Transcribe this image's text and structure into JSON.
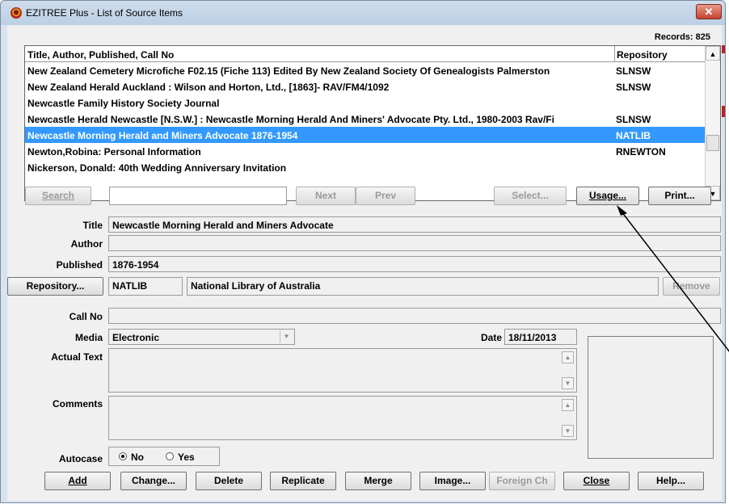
{
  "window": {
    "title": "EZITREE Plus - List of Source Items",
    "close_glyph": "✕"
  },
  "records_label": "Records: 825",
  "list": {
    "columns": [
      "Title, Author, Published, Call No",
      "Repository"
    ],
    "rows": [
      {
        "title": "New Zealand Cemetery Microfiche F02.15 (Fiche 113) Edited By New Zealand Society Of Genealogists Palmerston",
        "repo": "SLNSW"
      },
      {
        "title": "New Zealand Herald  Auckland : Wilson and Horton, Ltd., [1863]- RAV/FM4/1092",
        "repo": "SLNSW"
      },
      {
        "title": "Newcastle Family History Society Journal",
        "repo": ""
      },
      {
        "title": "Newcastle Herald  Newcastle [N.S.W.] : Newcastle Morning Herald And Miners' Advocate Pty. Ltd., 1980-2003 Rav/Fi",
        "repo": "SLNSW"
      },
      {
        "title": "Newcastle Morning Herald and Miners Advocate  1876-1954",
        "repo": "NATLIB",
        "selected": true
      },
      {
        "title": "Newton,Robina: Personal Information",
        "repo": "RNEWTON"
      },
      {
        "title": "Nickerson, Donald: 40th Wedding Anniversary Invitation",
        "repo": ""
      }
    ]
  },
  "search_bar": {
    "search": "Search",
    "search_value": "",
    "next": "Next",
    "prev": "Prev",
    "select": "Select...",
    "usage": "Usage...",
    "print": "Print..."
  },
  "form": {
    "title_label": "Title",
    "title_value": "Newcastle Morning Herald and Miners Advocate",
    "author_label": "Author",
    "author_value": "",
    "published_label": "Published",
    "published_value": "1876-1954",
    "repository_button": "Repository...",
    "repository_code": "NATLIB",
    "repository_name": "National Library of Australia",
    "remove_button": "Remove",
    "callno_label": "Call No",
    "callno_value": "",
    "media_label": "Media",
    "media_value": "Electronic",
    "date_label": "Date",
    "date_value": "18/11/2013",
    "actual_text_label": "Actual Text",
    "comments_label": "Comments",
    "autocase_label": "Autocase",
    "autocase_no": "No",
    "autocase_yes": "Yes",
    "autocase_selected": "No"
  },
  "bottom_buttons": {
    "add": "Add",
    "change": "Change...",
    "delete": "Delete",
    "replicate": "Replicate",
    "merge": "Merge",
    "image": "Image...",
    "foreign": "Foreign Ch",
    "close": "Close",
    "help": "Help..."
  }
}
